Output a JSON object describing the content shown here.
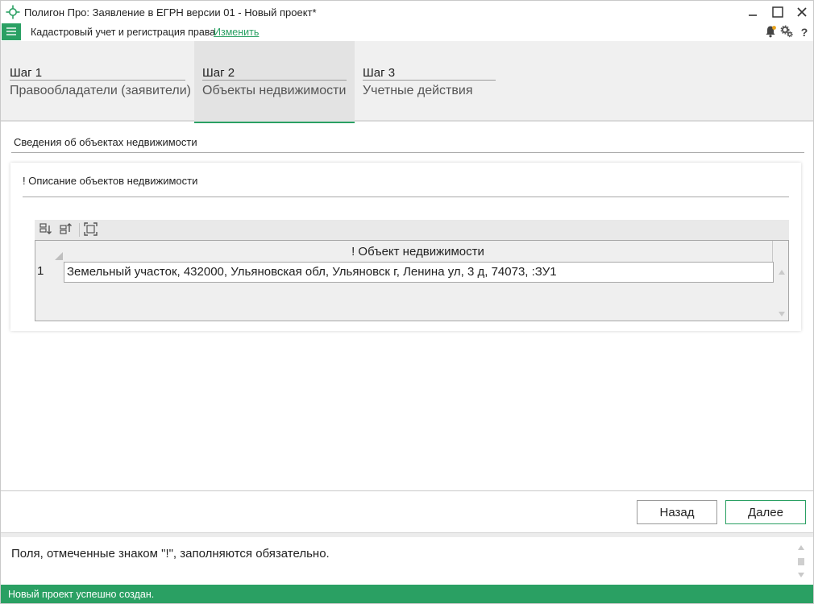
{
  "app": {
    "title": "Полигон Про: Заявление в ЕГРН версии 01 - Новый проект*",
    "logo_icon": "crosshair-logo-icon",
    "accent_color": "#2aa063"
  },
  "window_controls": {
    "minimize_icon": "minimize-icon",
    "maximize_icon": "maximize-icon",
    "close_icon": "close-icon"
  },
  "toolbar": {
    "menu_icon": "hamburger-menu-icon",
    "mode_label": "Кадастровый учет и регистрация права",
    "change_link": "Изменить",
    "icons": [
      "bell-icon",
      "gears-icon",
      "help-icon"
    ],
    "help_label": "?"
  },
  "steps": [
    {
      "number": "Шаг 1",
      "title": "Правообладатели (заявители)",
      "active": false
    },
    {
      "number": "Шаг 2",
      "title": "Объекты недвижимости",
      "active": true
    },
    {
      "number": "Шаг 3",
      "title": "Учетные действия",
      "active": false
    }
  ],
  "section": {
    "title": "Сведения об объектах недвижимости"
  },
  "panel": {
    "title": "! Описание объектов недвижимости",
    "grid_toolbar_icons": [
      "insert-row-below-icon",
      "insert-row-above-icon",
      "expand-editor-icon"
    ],
    "grid": {
      "columns": [
        "! Объект недвижимости"
      ],
      "rows": [
        {
          "num": "1",
          "value": "Земельный участок, 432000, Ульяновская обл, Ульяновск г, Ленина ул, 3 д, 74073, :ЗУ1"
        }
      ]
    }
  },
  "buttons": {
    "back": "Назад",
    "next": "Далее"
  },
  "hint": {
    "text": "Поля, отмеченные знаком \"!\", заполняются обязательно."
  },
  "status": {
    "text": "Новый проект успешно создан."
  }
}
